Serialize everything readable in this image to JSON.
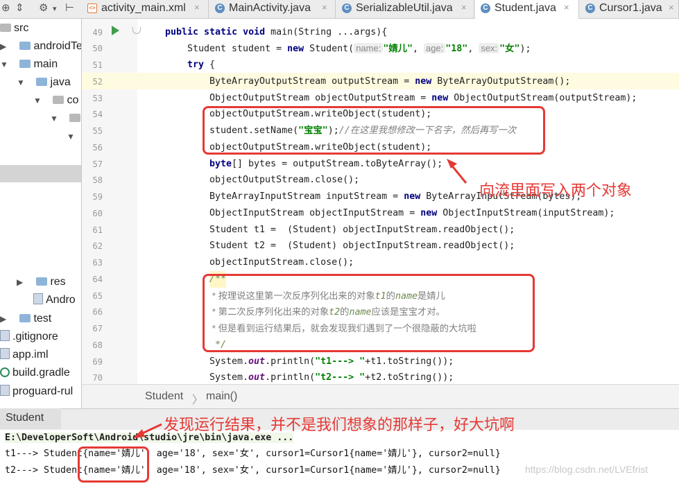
{
  "project_toolbar": {
    "split_icon": "split-icon",
    "gear_icon": "gear-icon",
    "collapse_icon": "collapse-icon"
  },
  "tabs": [
    {
      "label": "activity_main.xml",
      "icon": "xml-file-icon",
      "active": false
    },
    {
      "label": "MainActivity.java",
      "icon": "class-icon",
      "active": false
    },
    {
      "label": "SerializableUtil.java",
      "icon": "class-icon",
      "active": false
    },
    {
      "label": "Student.java",
      "icon": "class-icon",
      "active": true
    },
    {
      "label": "Cursor1.java",
      "icon": "class-icon",
      "active": false
    }
  ],
  "tab_close": "×",
  "sidebar": {
    "items": [
      {
        "label": "src"
      },
      {
        "label": "androidTe"
      },
      {
        "label": "main"
      },
      {
        "label": "java"
      },
      {
        "label": "co"
      },
      {
        "label": "res"
      },
      {
        "label": "Andro"
      },
      {
        "label": "test"
      },
      {
        "label": ".gitignore"
      },
      {
        "label": "app.iml"
      },
      {
        "label": "build.gradle"
      },
      {
        "label": "proguard-rul"
      }
    ]
  },
  "editor": {
    "line_numbers": [
      "49",
      "50",
      "51",
      "52",
      "53",
      "54",
      "55",
      "56",
      "57",
      "58",
      "59",
      "60",
      "61",
      "62",
      "63",
      "64",
      "65",
      "66",
      "67",
      "68",
      "69",
      "70"
    ],
    "code": {
      "l49_kw": "public static void",
      "l49_rest": " main(String ...args){",
      "l50_a": "Student student = ",
      "l50_new": "new",
      "l50_b": " Student(",
      "l50_hint_name": "name:",
      "l50_val_name": "\"婧儿\"",
      "l50_c": ", ",
      "l50_hint_age": "age:",
      "l50_val_age": "\"18\"",
      "l50_d": ", ",
      "l50_hint_sex": "sex:",
      "l50_val_sex": "\"女\"",
      "l50_e": ");",
      "l51_kw": "try",
      "l51_rest": " {",
      "l52_a": "ByteArrayOutputStream outputStream = ",
      "l52_new": "new",
      "l52_b": " ByteArrayOutputStream();",
      "l53_a": "ObjectOutputStream objectOutputStream = ",
      "l53_new": "new",
      "l53_b": " ObjectOutputStream(outputStream);",
      "l54": "objectOutputStream.writeObject(student);",
      "l55_a": "student.setName(",
      "l55_str": "\"宝宝\"",
      "l55_b": ");",
      "l55_cmt": "//在这里我想修改一下名字，然后再写一次",
      "l56": "objectOutputStream.writeObject(student);",
      "l57_kw": "byte",
      "l57_rest": "[] bytes = outputStream.toByteArray();",
      "l58": "objectOutputStream.close();",
      "l59_a": "ByteArrayInputStream inputStream = ",
      "l59_new": "new",
      "l59_b": " ByteArrayInputStream(bytes);",
      "l60_a": "ObjectInputStream objectInputStream = ",
      "l60_new": "new",
      "l60_b": " ObjectInputStream(inputStream);",
      "l61": "Student t1 =  (Student) objectInputStream.readObject();",
      "l62": "Student t2 =  (Student) objectInputStream.readObject();",
      "l63": "objectInputStream.close();",
      "l64": "/**",
      "l65_a": " * 按理说这里第一次反序列化出来的对象",
      "l65_t": "t1",
      "l65_b": "的",
      "l65_n": "name",
      "l65_c": "是婧儿",
      "l66_a": " * 第二次反序列化出来的对象",
      "l66_t": "t2",
      "l66_b": "的",
      "l66_n": "name",
      "l66_c": "应该是宝宝才对。",
      "l67": " * 但是看到运行结果后，就会发现我们遇到了一个很隐蔽的大坑啦",
      "l68": " */",
      "l69_a": "System.",
      "l69_out": "out",
      "l69_b": ".println(",
      "l69_str": "\"t1---> \"",
      "l69_c": "+t1.toString());",
      "l70_a": "System.",
      "l70_out": "out",
      "l70_b": ".println(",
      "l70_str": "\"t2---> \"",
      "l70_c": "+t2.toString());"
    }
  },
  "breadcrumb": {
    "class_name": "Student",
    "method_name": "main()",
    "separator": "〉"
  },
  "run_panel": {
    "tab_label": "Student",
    "command": "E:\\DeveloperSoft\\Android\\studio\\jre\\bin\\java.exe ...",
    "output": [
      "t1---> Student{name='婧儿', age='18', sex='女', cursor1=Cursor1{name='婧儿'}, cursor2=null}",
      "t2---> Student{name='婧儿', age='18', sex='女', cursor1=Cursor1{name='婧儿'}, cursor2=null}"
    ]
  },
  "annotations": {
    "write_two_objects": "向流里面写入两个对象",
    "result_not_expected": "发现运行结果，并不是我们想象的那样子，好大坑啊",
    "annotation_color": "#e53935"
  },
  "watermark": "https://blog.csdn.net/LVEfrist"
}
